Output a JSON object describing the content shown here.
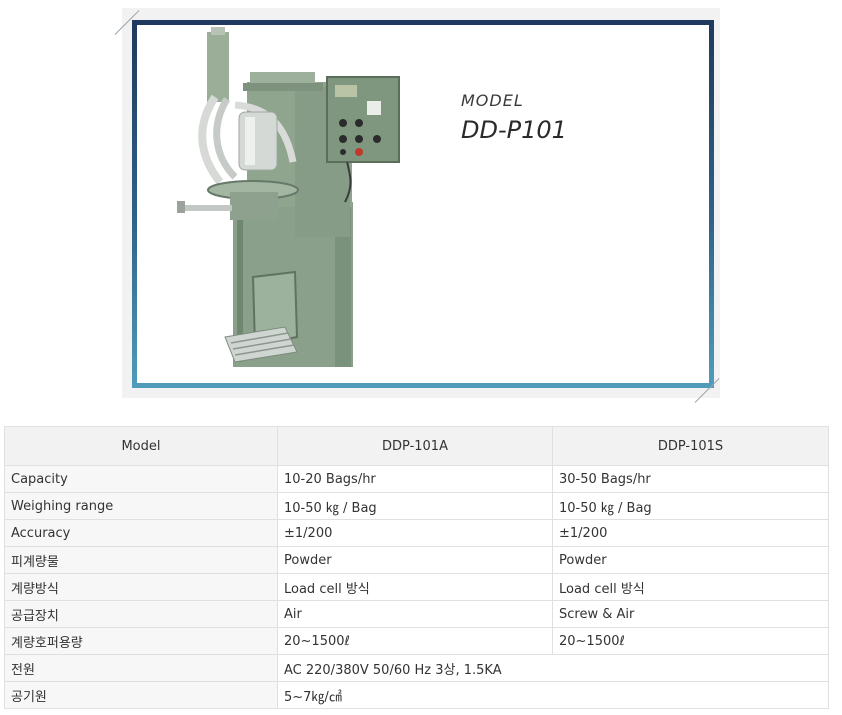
{
  "product": {
    "model_caption": "MODEL",
    "model_name": "DD-P101"
  },
  "table": {
    "headers": [
      "Model",
      "DDP-101A",
      "DDP-101S"
    ],
    "rows": [
      {
        "label": "Capacity",
        "a": "10-20 Bags/hr",
        "s": "30-50 Bags/hr"
      },
      {
        "label": "Weighing range",
        "a": "10-50 ㎏ / Bag",
        "s": "10-50 ㎏ / Bag"
      },
      {
        "label": "Accuracy",
        "a": "±1/200",
        "s": "±1/200"
      },
      {
        "label": "피계량물",
        "a": "Powder",
        "s": "Powder"
      },
      {
        "label": "계량방식",
        "a": "Load cell 방식",
        "s": "Load cell 방식"
      },
      {
        "label": "공급장치",
        "a": "Air",
        "s": "Screw & Air"
      },
      {
        "label": "계량호퍼용량",
        "a": "20~1500ℓ",
        "s": "20~1500ℓ"
      },
      {
        "label": "전원",
        "merged": "AC 220/380V 50/60 Hz 3상, 1.5KA"
      },
      {
        "label": "공기원",
        "merged": "5~7㎏/㎠"
      }
    ]
  }
}
